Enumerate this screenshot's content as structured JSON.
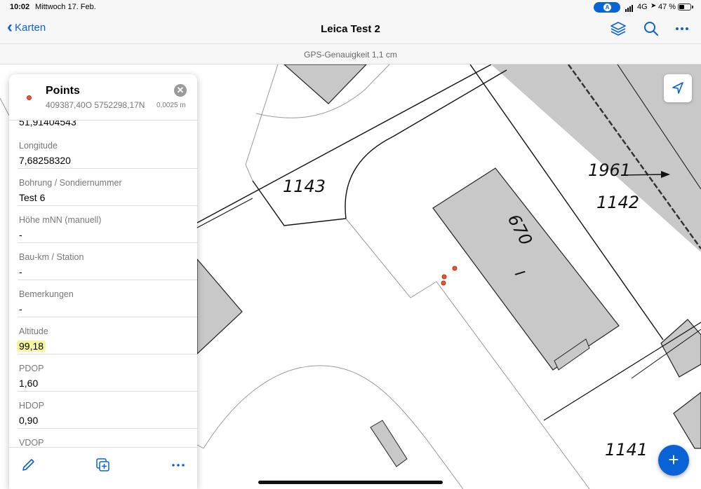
{
  "status_bar": {
    "time": "10:02",
    "date": "Mittwoch 17. Feb.",
    "account_badge": "A",
    "network": "4G",
    "battery": "47 %",
    "battery_level": 0.47
  },
  "nav": {
    "back_label": "Karten",
    "title": "Leica Test 2",
    "icons": [
      "layers-icon",
      "search-icon",
      "more-icon"
    ]
  },
  "gps_accuracy": "GPS-Genauigkeit 1,1 cm",
  "map": {
    "labels": [
      "1143",
      "670",
      "I",
      "1961",
      "1142",
      "1141"
    ],
    "icons": [
      "compass-icon",
      "add-icon"
    ]
  },
  "popup": {
    "title": "Points",
    "coordinates": "409387,40O 5752298,17N",
    "accuracy": "0,0025 m",
    "cut_value": "51,91404543",
    "fields": [
      {
        "label": "Longitude",
        "value": "7,68258320"
      },
      {
        "label": "Bohrung / Sondiernummer",
        "value": "Test 6"
      },
      {
        "label": "Höhe mNN (manuell)",
        "value": "-"
      },
      {
        "label": "Bau-km / Station",
        "value": "-"
      },
      {
        "label": "Bemerkungen",
        "value": "-"
      },
      {
        "label": "Altitude",
        "value": "99,18"
      },
      {
        "label": "PDOP",
        "value": "1,60"
      },
      {
        "label": "HDOP",
        "value": "0,90"
      },
      {
        "label": "VDOP",
        "value": ""
      }
    ],
    "footer_icons": [
      "edit-icon",
      "copy-icon",
      "more-icon"
    ]
  },
  "colors": {
    "accent": "#0a63d6",
    "building": "#c8c8c8",
    "point": "#e35a2a",
    "highlight": "#f7f59c"
  }
}
